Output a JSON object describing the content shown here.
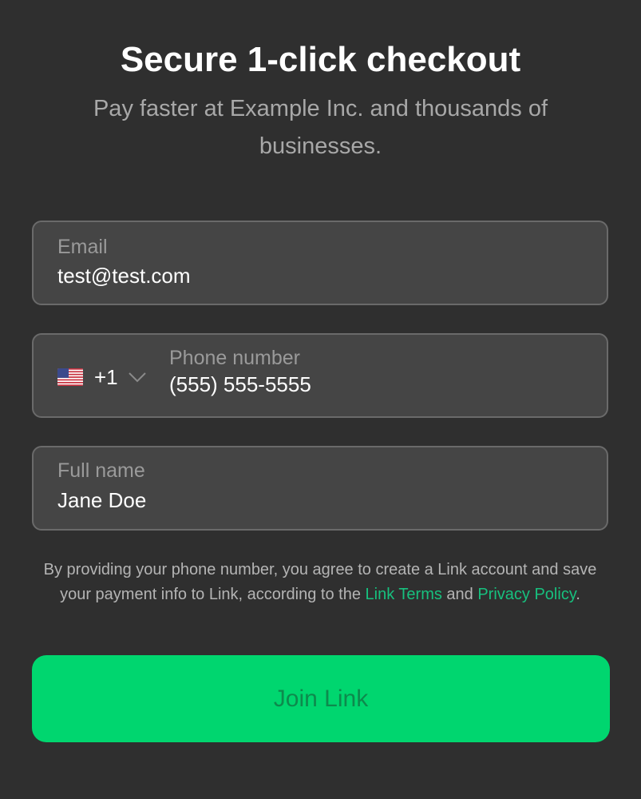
{
  "header": {
    "title": "Secure 1-click checkout",
    "subtitle": "Pay faster at Example Inc. and thousands of businesses."
  },
  "form": {
    "email": {
      "label": "Email",
      "value": "test@test.com"
    },
    "phone": {
      "label": "Phone number",
      "value": "(555) 555-5555",
      "country_flag_icon": "us-flag-icon",
      "country_code": "+1"
    },
    "full_name": {
      "label": "Full name",
      "value": "Jane Doe"
    }
  },
  "legal": {
    "text_before": "By providing your phone number, you agree to create a Link account and save your payment info to Link, according to the ",
    "terms_link": "Link Terms",
    "and_text": " and ",
    "privacy_link": "Privacy Policy",
    "text_after": "."
  },
  "actions": {
    "join_label": "Join Link"
  },
  "colors": {
    "background": "#2f2f2f",
    "field_background": "#454545",
    "field_border": "#6a6a6a",
    "link": "#17c07e",
    "button": "#00d66f",
    "button_text": "#0d8a4d"
  }
}
